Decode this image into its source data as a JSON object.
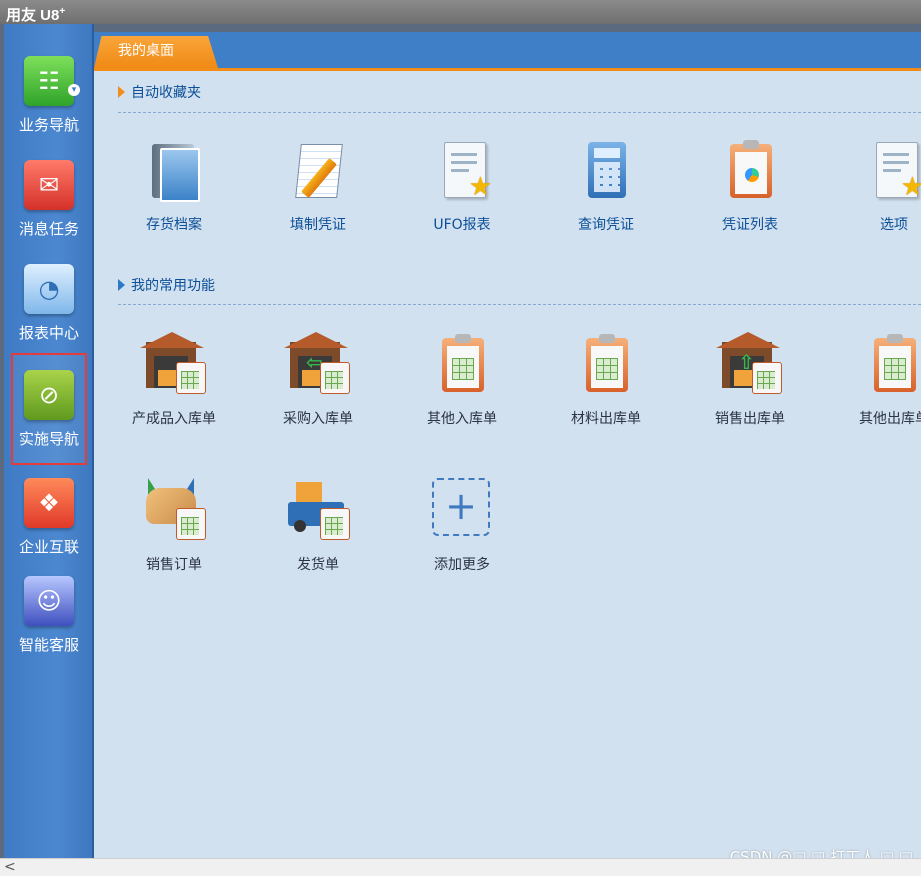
{
  "window": {
    "title": "用友 U8",
    "title_sup": "+"
  },
  "nav": {
    "items": [
      {
        "label": "业务导航",
        "icon": "business-nav-icon"
      },
      {
        "label": "消息任务",
        "icon": "message-task-icon"
      },
      {
        "label": "报表中心",
        "icon": "report-center-icon"
      },
      {
        "label": "实施导航",
        "icon": "compass-icon",
        "selected": true
      },
      {
        "label": "企业互联",
        "icon": "enterprise-link-icon"
      },
      {
        "label": "智能客服",
        "icon": "support-agent-icon"
      }
    ]
  },
  "tabs": {
    "active": "我的桌面"
  },
  "sections": {
    "favorites": {
      "title": "自动收藏夹",
      "items": [
        {
          "label": "存货档案",
          "icon": "inventory-file-icon"
        },
        {
          "label": "填制凭证",
          "icon": "fill-voucher-icon"
        },
        {
          "label": "UFO报表",
          "icon": "ufo-report-icon"
        },
        {
          "label": "查询凭证",
          "icon": "query-voucher-icon"
        },
        {
          "label": "凭证列表",
          "icon": "voucher-list-icon"
        },
        {
          "label": "选项",
          "icon": "options-icon"
        }
      ]
    },
    "common": {
      "title": "我的常用功能",
      "items": [
        {
          "label": "产成品入库单",
          "icon": "finished-goods-inbound-icon"
        },
        {
          "label": "采购入库单",
          "icon": "purchase-inbound-icon"
        },
        {
          "label": "其他入库单",
          "icon": "other-inbound-icon"
        },
        {
          "label": "材料出库单",
          "icon": "material-outbound-icon"
        },
        {
          "label": "销售出库单",
          "icon": "sales-outbound-icon"
        },
        {
          "label": "其他出库单",
          "icon": "other-outbound-icon"
        },
        {
          "label": "销售订单",
          "icon": "sales-order-icon"
        },
        {
          "label": "发货单",
          "icon": "delivery-note-icon"
        },
        {
          "label": "添加更多",
          "icon": "add-more-icon"
        }
      ]
    }
  },
  "watermark": "CSDN @□ □ 打工人 □ □",
  "scrollbar": {
    "left_arrow": "<"
  },
  "colors": {
    "accent_orange": "#f28d1a",
    "nav_blue": "#3f7bc4",
    "content_bg": "#d2e1f0",
    "label_blue": "#0c4f97",
    "selection_red": "#e43b3b"
  }
}
